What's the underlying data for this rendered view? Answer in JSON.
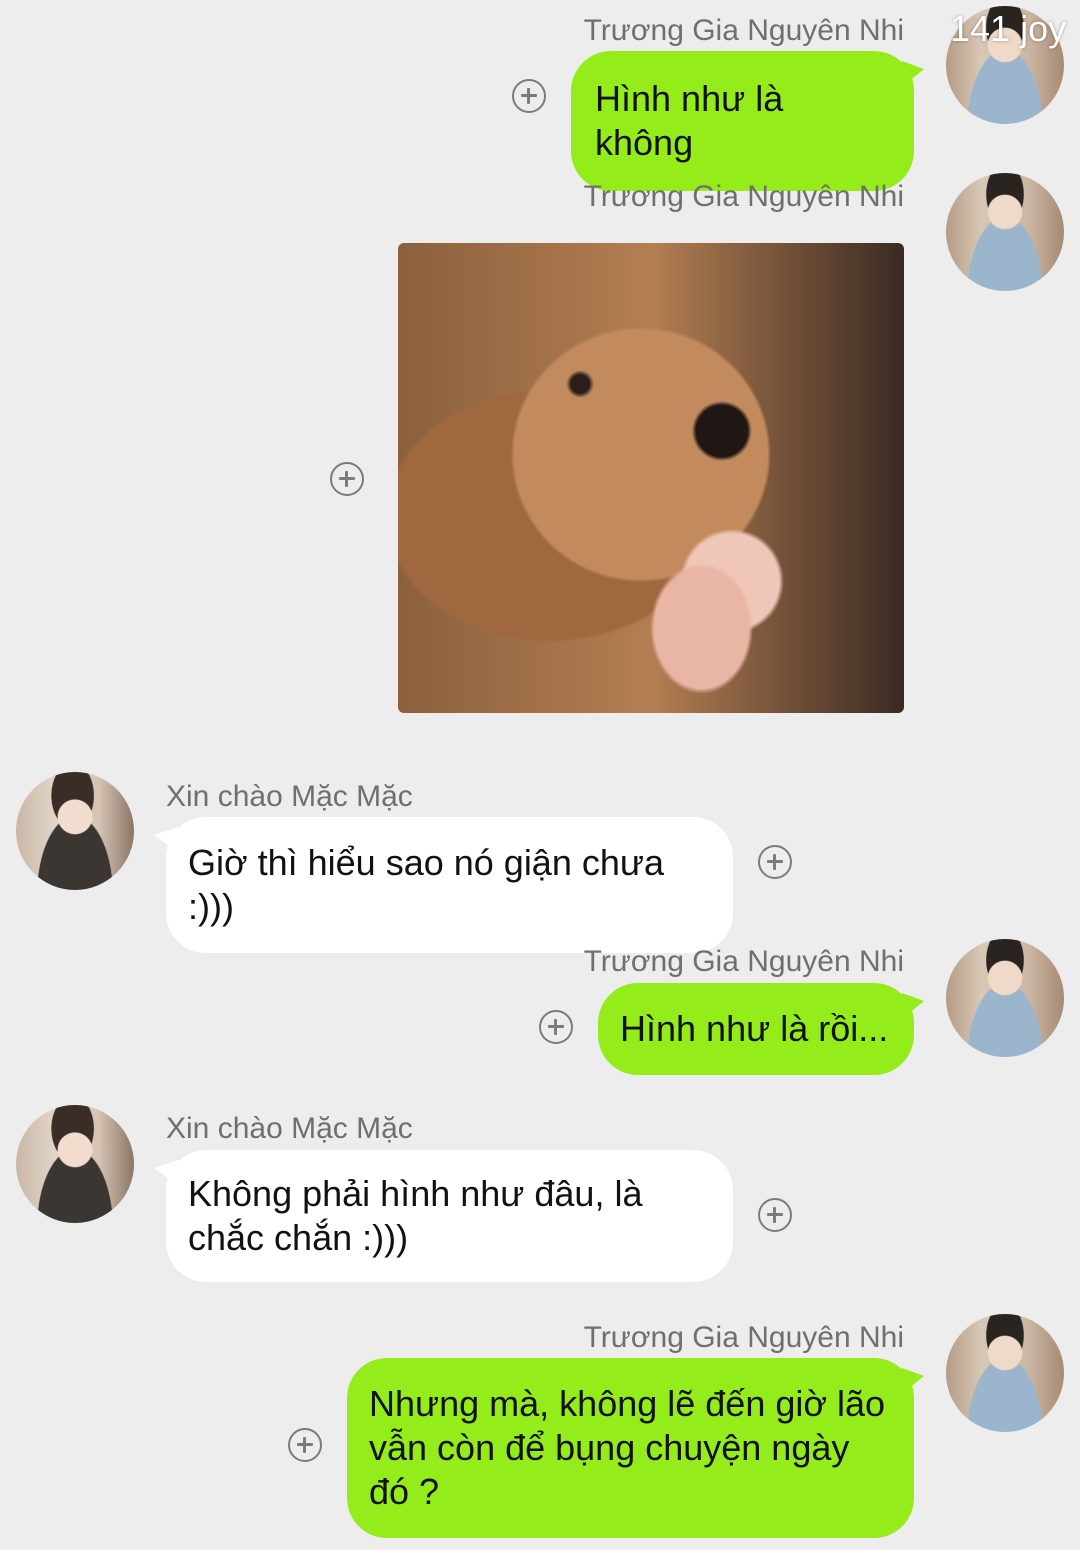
{
  "messages": [
    {
      "side": "right",
      "sender": "Trương Gia Nguyên Nhi",
      "text": "Hình như là không"
    },
    {
      "side": "right",
      "sender": "Trương Gia Nguyên Nhi",
      "sticker": "dog-sticker"
    },
    {
      "side": "left",
      "sender": "Xin chào Mặc Mặc",
      "text": "Giờ thì hiểu sao nó giận chưa :)))"
    },
    {
      "side": "right",
      "sender": "Trương Gia Nguyên Nhi",
      "text": "Hình như là rồi..."
    },
    {
      "side": "left",
      "sender": "Xin chào Mặc Mặc",
      "text": "Không phải hình như đâu, là chắc chắn :)))"
    },
    {
      "side": "right",
      "sender": "Trương Gia Nguyên Nhi",
      "text": "Nhưng mà, không lẽ đến giờ lão vẫn còn để bụng chuyện ngày đó ?"
    }
  ],
  "watermark": "141 joy",
  "colors": {
    "background": "#ededed",
    "outgoing_bubble": "#95ec1b",
    "incoming_bubble": "#ffffff"
  },
  "icons": {
    "add": "plus-circle-icon"
  }
}
